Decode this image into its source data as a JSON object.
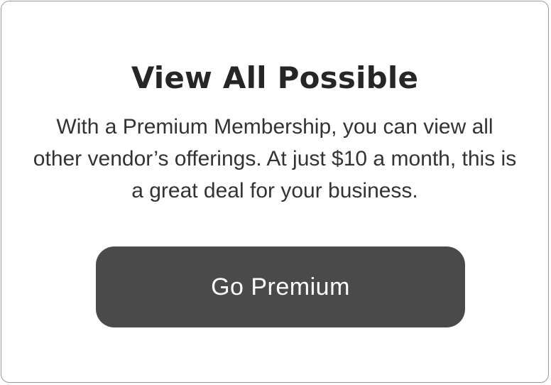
{
  "card": {
    "title": "View All Possible",
    "body": "With a Premium Membership, you can view all other vendor’s offerings. At just $10 a month, this is a great deal for your business.",
    "cta_label": "Go Premium"
  },
  "colors": {
    "button_bg": "#4a4a4a",
    "button_text": "#ffffff",
    "title_text": "#262626",
    "body_text": "#333333",
    "card_border": "#9a9a9a"
  }
}
